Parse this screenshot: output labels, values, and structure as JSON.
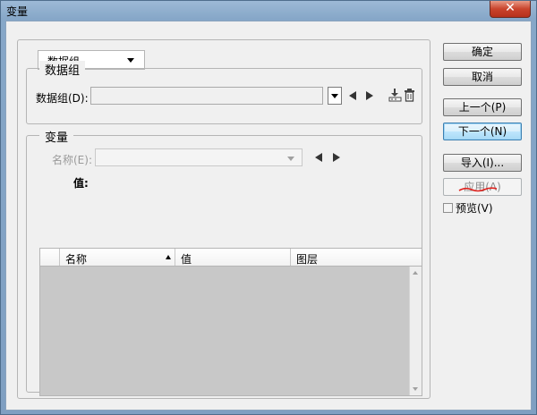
{
  "window": {
    "title": "变量",
    "close_glyph": "✕"
  },
  "mode_select": {
    "value": "数据组"
  },
  "dataset_group": {
    "title": "数据组",
    "field_label": "数据组(D):",
    "field_value": "",
    "icons": [
      "nav-left-icon",
      "nav-right-icon",
      "import-dataset-icon",
      "trash-icon"
    ]
  },
  "variables_group": {
    "title": "变量",
    "name_label": "名称(E):",
    "name_value": "",
    "value_label": "值:",
    "table": {
      "columns": [
        "名称",
        "值",
        "图层"
      ],
      "sort_column": "名称",
      "rows": []
    }
  },
  "buttons": {
    "ok": "确定",
    "cancel": "取消",
    "prev": "上一个(P)",
    "next": "下一个(N)",
    "import": "导入(I)...",
    "apply": "应用(A)"
  },
  "preview": {
    "label": "预览(V)",
    "checked": false
  },
  "colors": {
    "annotation": "#e0201c",
    "focus_border": "#3c7fb1"
  }
}
